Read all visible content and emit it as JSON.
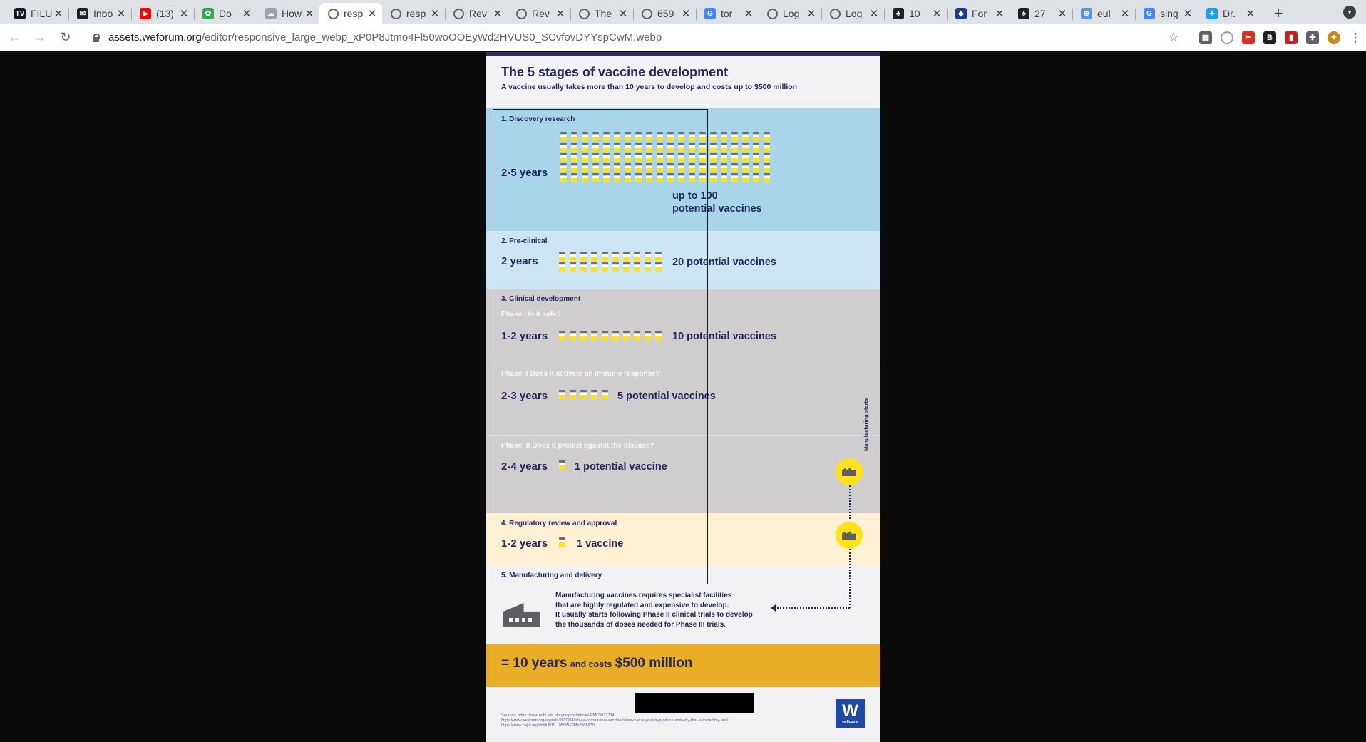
{
  "browser": {
    "tabs": [
      {
        "title": "FILU",
        "favicon": "tradingview-icon",
        "color": "#131722",
        "glyph": "TV"
      },
      {
        "title": "Inbo",
        "favicon": "mail-icon",
        "color": "#202124",
        "glyph": "✉"
      },
      {
        "title": "(13)",
        "favicon": "youtube-icon",
        "color": "#ff0000",
        "glyph": "▶"
      },
      {
        "title": "Do",
        "favicon": "leaf-icon",
        "color": "#34a853",
        "glyph": "✿"
      },
      {
        "title": "How",
        "favicon": "cloud-icon",
        "color": "#9aa0a6",
        "glyph": "☁"
      },
      {
        "title": "resp",
        "favicon": "globe-icon",
        "color": "",
        "glyph": ""
      },
      {
        "title": "resp",
        "favicon": "globe-icon",
        "color": "",
        "glyph": ""
      },
      {
        "title": "Rev",
        "favicon": "globe-icon",
        "color": "",
        "glyph": ""
      },
      {
        "title": "Rev",
        "favicon": "globe-icon",
        "color": "",
        "glyph": ""
      },
      {
        "title": "The",
        "favicon": "globe-icon",
        "color": "",
        "glyph": ""
      },
      {
        "title": "659",
        "favicon": "globe-icon",
        "color": "",
        "glyph": ""
      },
      {
        "title": "tor",
        "favicon": "google-icon",
        "color": "#4285f4",
        "glyph": "G"
      },
      {
        "title": "Log",
        "favicon": "globe-icon",
        "color": "",
        "glyph": ""
      },
      {
        "title": "Log",
        "favicon": "globe-icon",
        "color": "",
        "glyph": ""
      },
      {
        "title": "10",
        "favicon": "palm-icon",
        "color": "#202124",
        "glyph": "♣"
      },
      {
        "title": "For",
        "favicon": "diamond-icon",
        "color": "#1a3d8f",
        "glyph": "◆"
      },
      {
        "title": "27",
        "favicon": "palm-icon",
        "color": "#202124",
        "glyph": "♣"
      },
      {
        "title": "eul",
        "favicon": "who-icon",
        "color": "#5b92e5",
        "glyph": "⊕"
      },
      {
        "title": "sing",
        "favicon": "google-icon",
        "color": "#4285f4",
        "glyph": "G"
      },
      {
        "title": "Dr.",
        "favicon": "twitter-icon",
        "color": "#1d9bf0",
        "glyph": "✦"
      }
    ],
    "active_tab": 5,
    "url_host": "assets.weforum.org",
    "url_path": "/editor/responsive_large_webp_xP0P8Jtmo4Fl50woOOEyWd2HVUS0_SCvfovDYYspCwM.webp"
  },
  "infographic": {
    "title": "The 5 stages of vaccine development",
    "subtitle": "A vaccine usually takes more than 10 years to develop and costs up to $500 million",
    "stage1": {
      "label": "1. Discovery research",
      "years": "2-5 years",
      "count_line1": "up to 100",
      "count_line2": "potential vaccines"
    },
    "stage2": {
      "label": "2. Pre-clinical",
      "years": "2 years",
      "count": "20 potential vaccines"
    },
    "stage3": {
      "label": "3. Clinical development",
      "phase1": {
        "question": "Phase I Is it safe?",
        "years": "1-2 years",
        "count": "10 potential vaccines"
      },
      "phase2": {
        "question": "Phase II Does it activate an immune response?",
        "years": "2-3 years",
        "count": "5 potential vaccines"
      },
      "phase3": {
        "question": "Phase III Does it protect against the disease?",
        "years": "2-4 years",
        "count": "1 potential vaccine"
      }
    },
    "manufacturing_starts": "Manufacturing starts",
    "stage4": {
      "label": "4. Regulatory review and approval",
      "years": "1-2 years",
      "count": "1 vaccine"
    },
    "stage5": {
      "label": "5. Manufacturing and delivery",
      "text1": "Manufacturing vaccines requires specialist facilities",
      "text2": "that are highly regulated and expensive to develop.",
      "text3": "It usually starts following Phase II clinical trials to develop",
      "text4": "the thousands of doses needed for Phase III trials."
    },
    "total": {
      "part1": "= 10 years",
      "part2": "and costs",
      "part3": "$500 million"
    },
    "sources": {
      "line1": "Sources: https://www.ncbi.nlm.nih.gov/pmc/articles/PMC5013734/",
      "line2": "https://www.weforum.org/agenda/2020/04/why-a-coronavirus-vaccine-takes-over-a-year-to-produce-and-why-that-is-incredibly-fast/",
      "line3": "https://www.nejm.org/doi/full/10.1056/NEJMp2005630"
    },
    "logo": {
      "letter": "W",
      "name": "wellcome"
    },
    "vial_counts": {
      "stage1": 100,
      "stage2": 20,
      "phase1": 10,
      "phase2": 5,
      "phase3": 1,
      "stage4": 1
    },
    "colors": {
      "navy": "#23275c",
      "yellow": "#ffe21a",
      "gold": "#e9ad26",
      "blue": "#a9d5ea"
    }
  }
}
